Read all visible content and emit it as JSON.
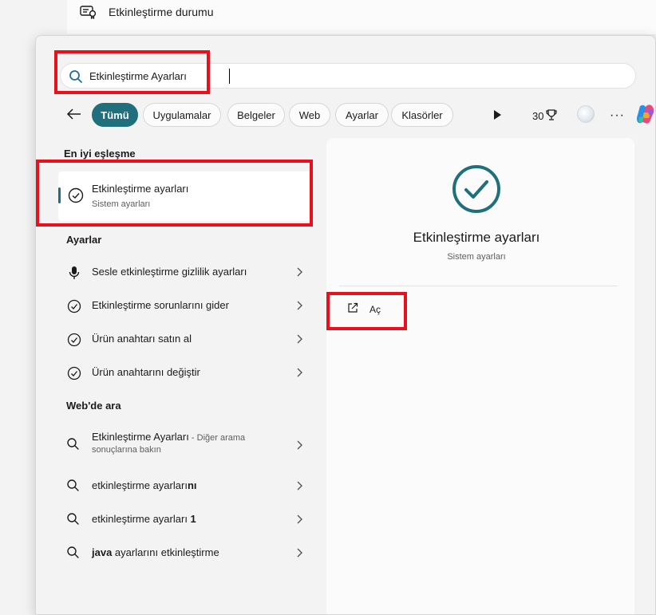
{
  "background": {
    "activation_status_label": "Etkinleştirme durumu"
  },
  "search": {
    "query": "Etkinleştirme Ayarları"
  },
  "filters": {
    "tabs": [
      "Tümü",
      "Uygulamalar",
      "Belgeler",
      "Web",
      "Ayarlar",
      "Klasörler"
    ],
    "active_tab": "Tümü",
    "points": "30"
  },
  "best_match": {
    "section_title": "En iyi eşleşme",
    "title": "Etkinleştirme ayarları",
    "subtitle": "Sistem ayarları"
  },
  "settings": {
    "section_title": "Ayarlar",
    "items": [
      {
        "label": "Sesle etkinleştirme gizlilik ayarları",
        "icon": "microphone-icon"
      },
      {
        "label": "Etkinleştirme sorunlarını gider",
        "icon": "check-circle-icon"
      },
      {
        "label": "Ürün anahtarı satın al",
        "icon": "check-circle-icon"
      },
      {
        "label": "Ürün anahtarını değiştir",
        "icon": "check-circle-icon"
      }
    ]
  },
  "web": {
    "section_title": "Web'de ara",
    "first": {
      "query": "Etkinleştirme Ayarları",
      "hint": " - Diğer arama",
      "hint2": "sonuçlarına bakın"
    },
    "items": [
      {
        "prefix": "etkinleştirme ayarları",
        "bold": "nı"
      },
      {
        "prefix": "etkinleştirme ayarları ",
        "bold": "1"
      },
      {
        "prefix": "",
        "bold": "java",
        "suffix": " ayarlarını etkinleştirme"
      }
    ]
  },
  "preview": {
    "title": "Etkinleştirme ayarları",
    "subtitle": "Sistem ayarları",
    "open_label": "Aç"
  },
  "colors": {
    "accent": "#1f6f7c",
    "highlight": "#e8101d"
  }
}
